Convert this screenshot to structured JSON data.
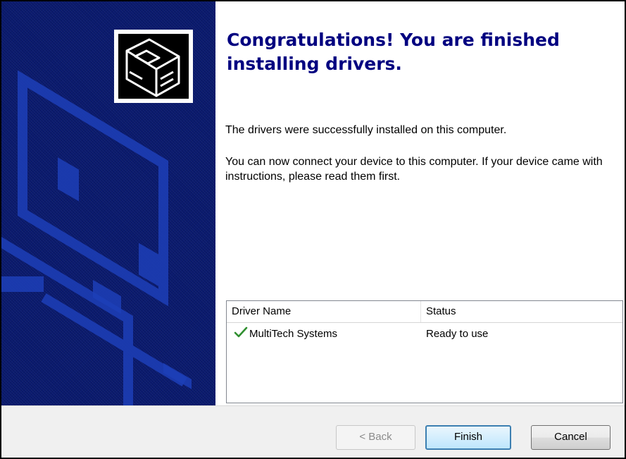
{
  "wizard": {
    "heading": "Congratulations! You are finished installing drivers.",
    "success_text": "The drivers were successfully installed on this computer.",
    "instructions_text": "You can now connect your device to this computer. If your device came with instructions, please read them first.",
    "banner_icon": "hardware-drive-icon"
  },
  "driver_list": {
    "columns": [
      "Driver Name",
      "Status"
    ],
    "rows": [
      {
        "name": "MultiTech Systems",
        "status": "Ready to use",
        "icon": "checkmark-icon",
        "icon_color": "#2f8f2f"
      }
    ]
  },
  "buttons": {
    "back_label": "< Back",
    "finish_label": "Finish",
    "cancel_label": "Cancel"
  },
  "colors": {
    "banner": "#0a1a6e",
    "heading": "#000080",
    "default_button_border": "#3c7fb1"
  }
}
